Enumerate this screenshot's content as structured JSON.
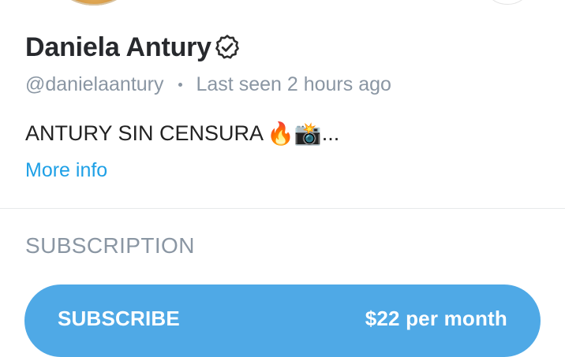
{
  "profile": {
    "display_name": "Daniela Antury",
    "handle": "@danielaantury",
    "last_seen": "Last seen 2 hours ago",
    "bio_text": "ANTURY SIN CENSURA ",
    "bio_emojis": "🔥📸",
    "bio_ellipsis": "...",
    "more_info_label": "More info"
  },
  "subscription": {
    "section_title": "SUBSCRIPTION",
    "button_label": "SUBSCRIBE",
    "price_label": "$22 per month"
  },
  "colors": {
    "accent": "#4fa9e6",
    "link": "#1ea0e6",
    "muted_text": "#8a96a3",
    "primary_text": "#27292d"
  },
  "icons": {
    "verified": "verified-badge-icon"
  }
}
